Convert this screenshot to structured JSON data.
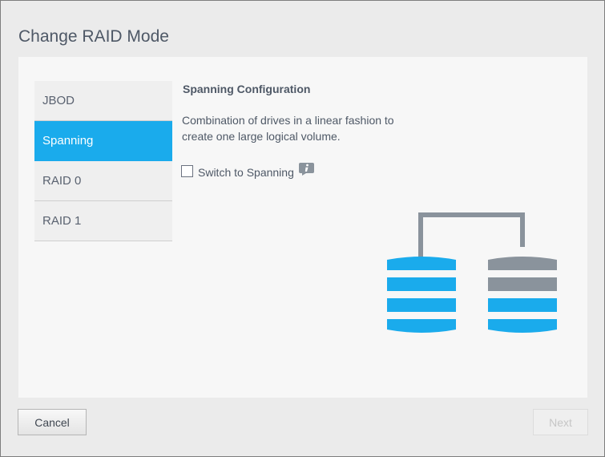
{
  "dialog": {
    "title": "Change RAID Mode"
  },
  "modes": [
    {
      "label": "JBOD",
      "active": false
    },
    {
      "label": "Spanning",
      "active": true
    },
    {
      "label": "RAID 0",
      "active": false
    },
    {
      "label": "RAID 1",
      "active": false
    }
  ],
  "config": {
    "title": "Spanning Configuration",
    "description": "Combination of drives in a linear fashion to create one large logical volume.",
    "switch_label": "Switch to Spanning",
    "switch_checked": false
  },
  "buttons": {
    "cancel": "Cancel",
    "next": "Next"
  },
  "colors": {
    "accent": "#1aabec",
    "inactive_disk": "#8a939c",
    "connector": "#8a939c"
  },
  "icons": {
    "info": "info-icon"
  }
}
